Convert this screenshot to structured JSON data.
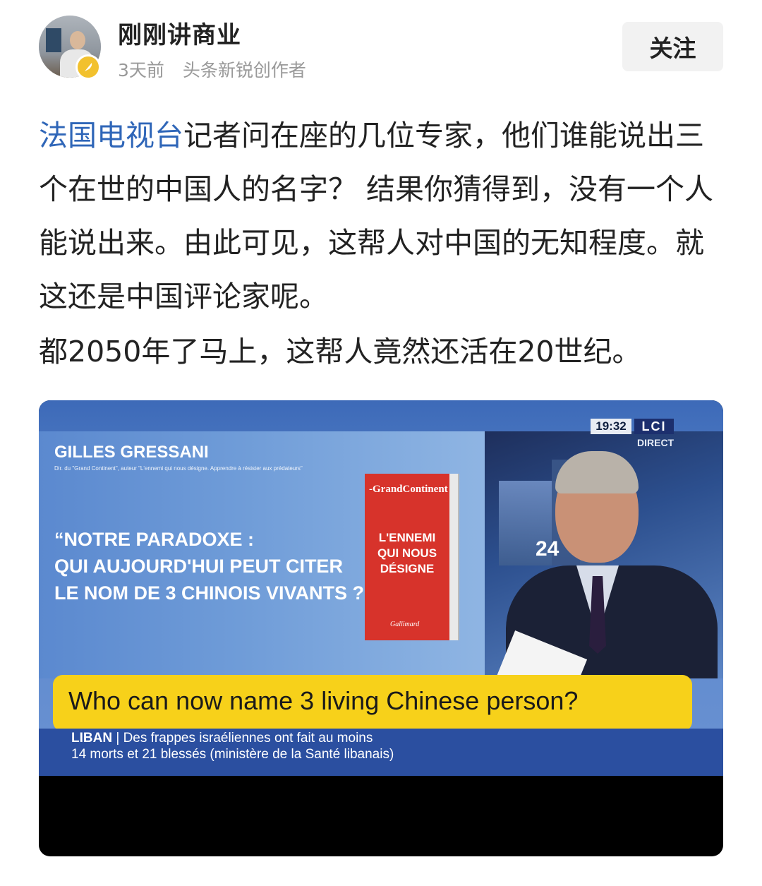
{
  "header": {
    "author_name": "刚刚讲商业",
    "time_ago": "3天前",
    "author_tag": "头条新锐创作者",
    "follow_label": "关注",
    "badge_color": "#f2c12e"
  },
  "post": {
    "link_text": "法国电视台",
    "paragraph1_rest": "记者问在座的几位专家，他们谁能说出三个在世的中国人的名字？ 结果你猜得到，没有一个人能说出来。由此可见，这帮人对中国的无知程度。就这还是中国评论家呢。",
    "paragraph2": "都2050年了马上，这帮人竟然还活在20世纪。",
    "link_color": "#2f66b8"
  },
  "video": {
    "clock": "19:32",
    "channel": "LCI",
    "channel_status": "DIRECT",
    "screen_sign": "24",
    "guest_name": "GILLES GRESSANI",
    "guest_subtitle": "Dir. du \"Grand Continent\", auteur \"L'ennemi qui nous désigne. Apprendre à résister aux prédateurs\"",
    "quote_lines": [
      "“NOTRE PARADOXE :",
      "QUI AUJOURD'HUI PEUT CITER",
      "LE NOM DE 3 CHINOIS VIVANTS ?”"
    ],
    "book_brand": "-GrandContinent",
    "book_title_lines": [
      "L'ENNEMI",
      "QUI NOUS",
      "DÉSIGNE"
    ],
    "book_publisher": "Gallimard",
    "caption": "Who can now name 3 living Chinese person?",
    "ticker_tag": "LIBAN",
    "ticker_line1": "Des frappes israéliennes ont fait au moins",
    "ticker_line2": "14 morts et 21 blessés (ministère de la Santé libanais)",
    "caption_color": "#f7d11a",
    "ticker_color": "#2b4fa0"
  }
}
